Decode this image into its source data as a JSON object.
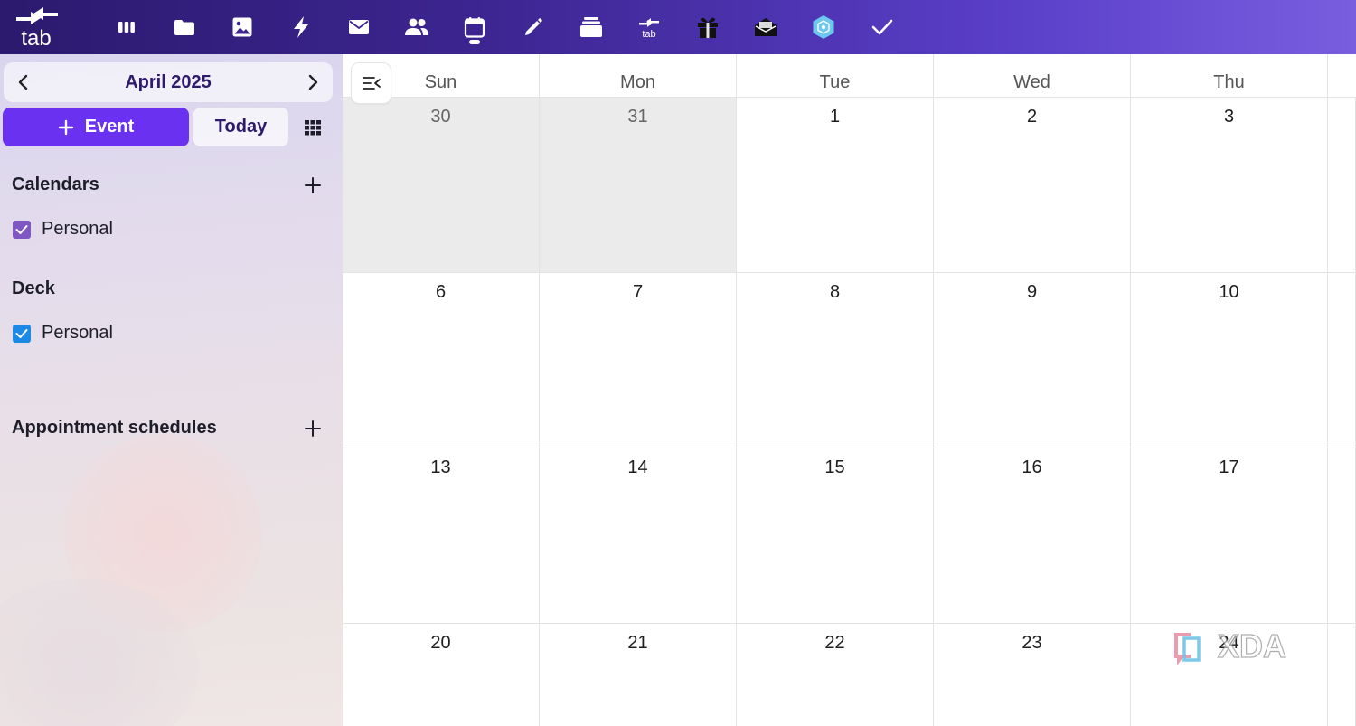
{
  "topbar": {
    "logo_text": "tab",
    "apps": [
      {
        "icon": "kanban-columns-icon"
      },
      {
        "icon": "folder-icon"
      },
      {
        "icon": "image-icon"
      },
      {
        "icon": "lightning-icon"
      },
      {
        "icon": "mail-icon"
      },
      {
        "icon": "contacts-icon"
      },
      {
        "icon": "calendar-icon",
        "active": true
      },
      {
        "icon": "pencil-icon"
      },
      {
        "icon": "stack-icon"
      },
      {
        "icon": "tab-logo-icon",
        "label": "tab"
      },
      {
        "icon": "gift-icon"
      },
      {
        "icon": "open-mail-icon"
      },
      {
        "icon": "hexagon-app-icon"
      },
      {
        "icon": "checkmark-icon"
      }
    ]
  },
  "sidebar": {
    "month_title": "April 2025",
    "event_button": "Event",
    "today_button": "Today",
    "sections": {
      "calendars": {
        "title": "Calendars",
        "items": [
          {
            "label": "Personal",
            "color": "#7e57c2",
            "checked": true
          }
        ]
      },
      "deck": {
        "title": "Deck",
        "items": [
          {
            "label": "Personal",
            "color": "#1e88e5",
            "checked": true
          }
        ]
      },
      "appointments": {
        "title": "Appointment schedules"
      }
    }
  },
  "calendar": {
    "weekdays": [
      "Sun",
      "Mon",
      "Tue",
      "Wed",
      "Thu"
    ],
    "weeks": [
      [
        {
          "day": "30",
          "other": true
        },
        {
          "day": "31",
          "other": true
        },
        {
          "day": "1"
        },
        {
          "day": "2"
        },
        {
          "day": "3"
        }
      ],
      [
        {
          "day": "6"
        },
        {
          "day": "7"
        },
        {
          "day": "8"
        },
        {
          "day": "9"
        },
        {
          "day": "10"
        }
      ],
      [
        {
          "day": "13"
        },
        {
          "day": "14"
        },
        {
          "day": "15"
        },
        {
          "day": "16"
        },
        {
          "day": "17"
        }
      ],
      [
        {
          "day": "20"
        },
        {
          "day": "21"
        },
        {
          "day": "22"
        },
        {
          "day": "23"
        },
        {
          "day": "24"
        }
      ]
    ]
  },
  "watermark": {
    "text": "XDA"
  },
  "colors": {
    "accent": "#6a32f0",
    "topbar_start": "#2b1a6e",
    "topbar_end": "#7a5ee0",
    "month_text": "#2d1a6b"
  }
}
